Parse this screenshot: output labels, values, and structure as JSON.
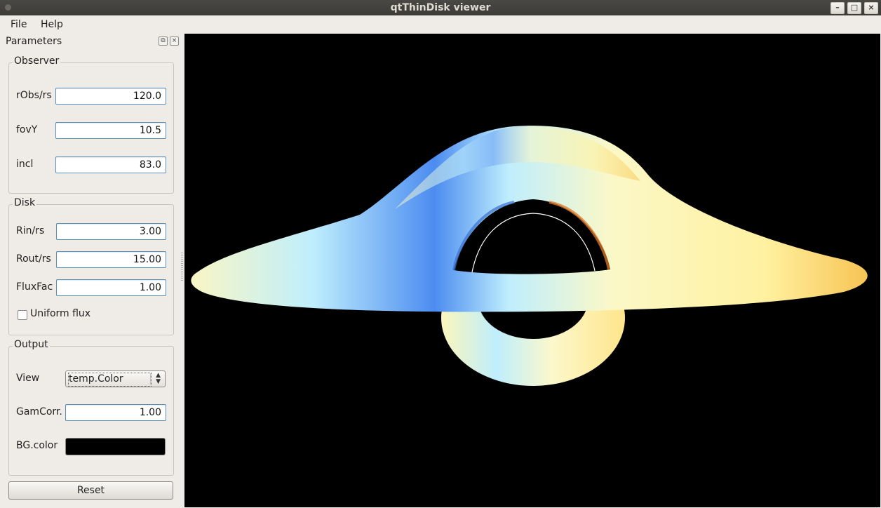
{
  "window": {
    "title": "qtThinDisk viewer"
  },
  "menubar": {
    "file": "File",
    "help": "Help"
  },
  "dock": {
    "title": "Parameters"
  },
  "observer": {
    "title": "Observer",
    "robs_label": "rObs/rs",
    "robs_value": "120.0",
    "fovy_label": "fovY",
    "fovy_value": "10.5",
    "incl_label": "incl",
    "incl_value": "83.0"
  },
  "disk": {
    "title": "Disk",
    "rin_label": "Rin/rs",
    "rin_value": "3.00",
    "rout_label": "Rout/rs",
    "rout_value": "15.00",
    "fluxfac_label": "FluxFac",
    "fluxfac_value": "1.00",
    "uniform_label": "Uniform flux",
    "uniform_checked": false
  },
  "output": {
    "title": "Output",
    "view_label": "View",
    "view_value": "temp.Color",
    "gamcorr_label": "GamCorr.",
    "gamcorr_value": "1.00",
    "bgcolor_label": "BG.color",
    "bgcolor_value": "#000000"
  },
  "reset_label": "Reset",
  "render": {
    "background": "#000000",
    "colors": {
      "blue": "#4c8cf0",
      "cyan": "#bfeefd",
      "cream": "#f9f6c4",
      "yellow": "#fff3a0",
      "orange": "#f7c455"
    }
  }
}
